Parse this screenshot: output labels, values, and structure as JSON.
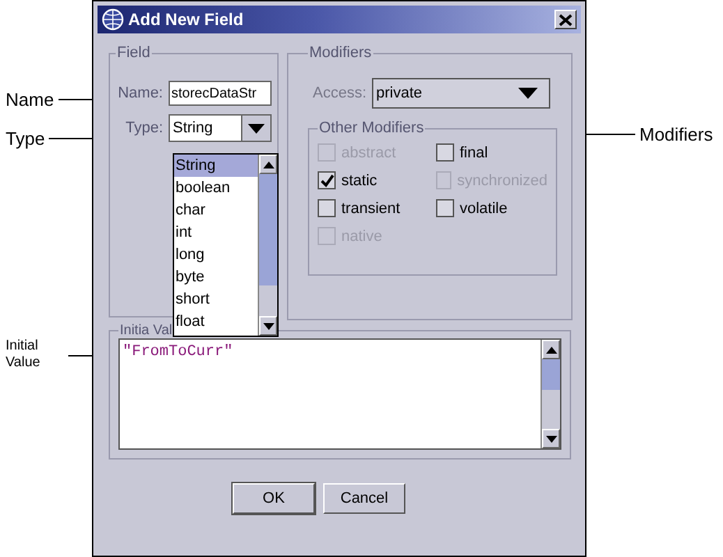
{
  "callouts_left": [
    {
      "text": "Name"
    },
    {
      "text": "Type"
    },
    {
      "text": "Initial Value"
    }
  ],
  "callouts_right": [
    {
      "text": "Modifiers"
    }
  ],
  "dialog": {
    "title": "Add New Field",
    "field_group": {
      "legend": "Field",
      "name_label": "Name:",
      "name_value": "storecDataStr",
      "type_label": "Type:",
      "type_value": "String",
      "type_options": [
        {
          "label": "String",
          "selected": true
        },
        {
          "label": "boolean",
          "selected": false
        },
        {
          "label": "char",
          "selected": false
        },
        {
          "label": "int",
          "selected": false
        },
        {
          "label": "long",
          "selected": false
        },
        {
          "label": "byte",
          "selected": false
        },
        {
          "label": "short",
          "selected": false
        },
        {
          "label": "float",
          "selected": false
        }
      ]
    },
    "modifiers_group": {
      "legend": "Modifiers",
      "access_label": "Access:",
      "access_value": "private",
      "other_legend": "Other Modifiers",
      "checkboxes": [
        {
          "label": "abstract",
          "checked": false,
          "disabled": true
        },
        {
          "label": "final",
          "checked": false,
          "disabled": false
        },
        {
          "label": "static",
          "checked": true,
          "disabled": false
        },
        {
          "label": "synchronized",
          "checked": false,
          "disabled": true
        },
        {
          "label": "transient",
          "checked": false,
          "disabled": false
        },
        {
          "label": "volatile",
          "checked": false,
          "disabled": false
        },
        {
          "label": "native",
          "checked": false,
          "disabled": true
        }
      ]
    },
    "initial_value": {
      "legend": "Initia Val",
      "value": "\"FromToCurr\""
    },
    "buttons": [
      "OK",
      "Cancel"
    ]
  }
}
